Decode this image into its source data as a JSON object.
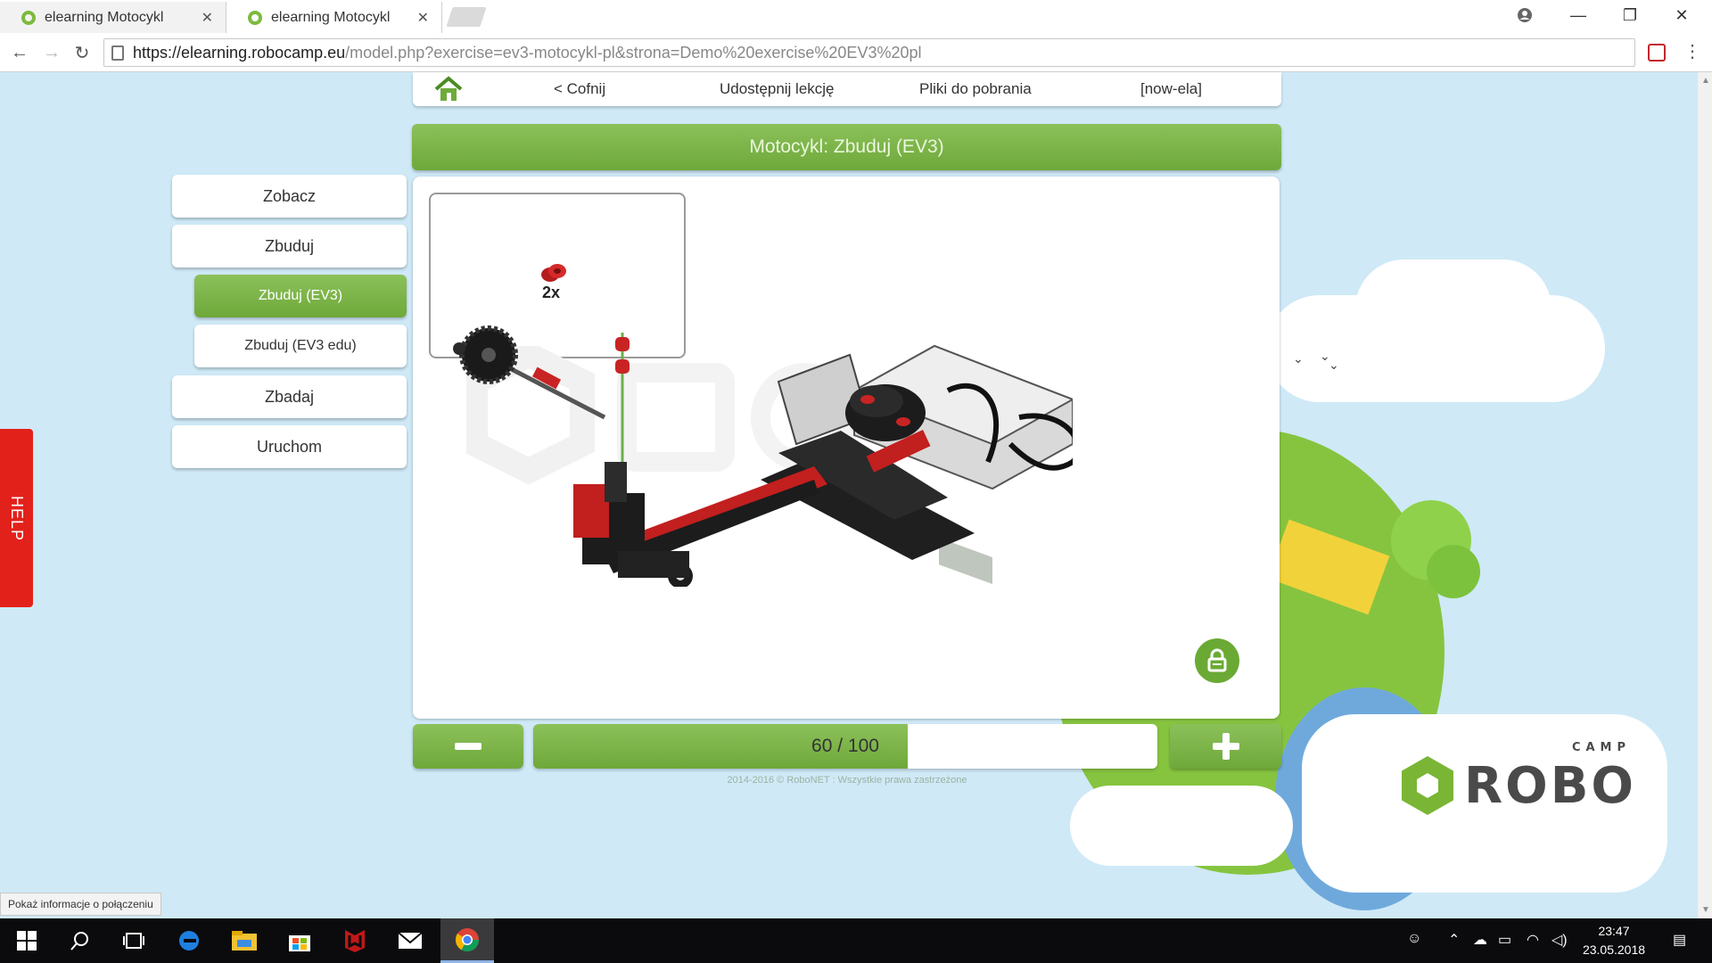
{
  "browser": {
    "tabs": [
      {
        "title": "elearning Motocykl",
        "active": false
      },
      {
        "title": "elearning Motocykl",
        "active": true
      }
    ],
    "url_host": "https://elearning.robocamp.eu",
    "url_rest": "/model.php?exercise=ev3-motocykl-pl&strona=Demo%20exercise%20EV3%20pl",
    "status_tooltip": "Pokaż informacje o połączeniu"
  },
  "nav": {
    "back": "< Cofnij",
    "share": "Udostępnij lekcję",
    "downloads": "Pliki do pobrania",
    "user": "[now-ela]"
  },
  "page_title": "Motocykl: Zbuduj (EV3)",
  "menu": [
    {
      "label": "Zobacz"
    },
    {
      "label": "Zbuduj"
    },
    {
      "label": "Zbuduj (EV3)"
    },
    {
      "label": "Zbuduj (EV3 edu)"
    },
    {
      "label": "Zbadaj"
    },
    {
      "label": "Uruchom"
    }
  ],
  "help_label": "HELP",
  "step": {
    "parts_count": "2x",
    "current": 60,
    "total": 100,
    "label": "60 / 100"
  },
  "footer": "2014-2016 © RoboNET : Wszystkie prawa zastrzeżone",
  "logo": {
    "name": "ROBO",
    "sub": "CAMP"
  },
  "taskbar": {
    "time": "23:47",
    "date": "23.05.2018"
  },
  "colors": {
    "accent_green": "#7ab535",
    "help_red": "#e3211b",
    "page_bg": "#cfe9f7"
  }
}
